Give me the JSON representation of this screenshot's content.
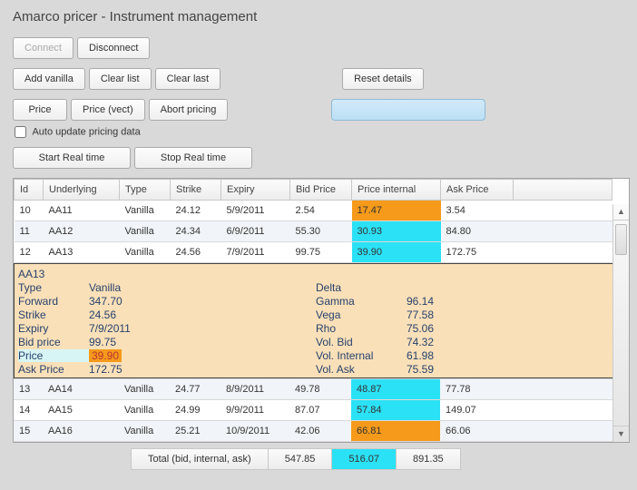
{
  "title": "Amarco pricer - Instrument management",
  "buttons": {
    "connect": "Connect",
    "disconnect": "Disconnect",
    "add_vanilla": "Add vanilla",
    "clear_list": "Clear list",
    "clear_last": "Clear last",
    "reset_details": "Reset details",
    "price": "Price",
    "price_vect": "Price (vect)",
    "abort_pricing": "Abort pricing",
    "start_rt": "Start Real time",
    "stop_rt": "Stop Real time"
  },
  "checkbox": {
    "auto_update": "Auto update pricing data"
  },
  "columns": {
    "id": "Id",
    "underlying": "Underlying",
    "type": "Type",
    "strike": "Strike",
    "expiry": "Expiry",
    "bid": "Bid Price",
    "internal": "Price internal",
    "ask": "Ask Price"
  },
  "rows": [
    {
      "id": "10",
      "underlying": "AA11",
      "type": "Vanilla",
      "strike": "24.12",
      "expiry": "5/9/2011",
      "bid": "2.54",
      "internal": "17.47",
      "ask": "3.54",
      "hl": "orange"
    },
    {
      "id": "11",
      "underlying": "AA12",
      "type": "Vanilla",
      "strike": "24.34",
      "expiry": "6/9/2011",
      "bid": "55.30",
      "internal": "30.93",
      "ask": "84.80",
      "hl": "cyan"
    },
    {
      "id": "12",
      "underlying": "AA13",
      "type": "Vanilla",
      "strike": "24.56",
      "expiry": "7/9/2011",
      "bid": "99.75",
      "internal": "39.90",
      "ask": "172.75",
      "hl": "cyan"
    },
    {
      "id": "13",
      "underlying": "AA14",
      "type": "Vanilla",
      "strike": "24.77",
      "expiry": "8/9/2011",
      "bid": "49.78",
      "internal": "48.87",
      "ask": "77.78",
      "hl": "cyan"
    },
    {
      "id": "14",
      "underlying": "AA15",
      "type": "Vanilla",
      "strike": "24.99",
      "expiry": "9/9/2011",
      "bid": "87.07",
      "internal": "57.84",
      "ask": "149.07",
      "hl": "cyan"
    },
    {
      "id": "15",
      "underlying": "AA16",
      "type": "Vanilla",
      "strike": "25.21",
      "expiry": "10/9/2011",
      "bid": "42.06",
      "internal": "66.81",
      "ask": "66.06",
      "hl": "orange"
    }
  ],
  "detail": {
    "name": "AA13",
    "type_label": "Type",
    "type_value": "Vanilla",
    "forward_label": "Forward",
    "forward_value": "347.70",
    "strike_label": "Strike",
    "strike_value": "24.56",
    "expiry_label": "Expiry",
    "expiry_value": "7/9/2011",
    "bid_label": "Bid price",
    "bid_value": "99.75",
    "price_label": "Price",
    "price_value": "39.90",
    "ask_label": "Ask Price",
    "ask_value": "172.75",
    "delta_label": "Delta",
    "delta_value": "",
    "gamma_label": "Gamma",
    "gamma_value": "96.14",
    "vega_label": "Vega",
    "vega_value": "77.58",
    "rho_label": "Rho",
    "rho_value": "75.06",
    "volbid_label": "Vol. Bid",
    "volbid_value": "74.32",
    "volint_label": "Vol. Internal",
    "volint_value": "61.98",
    "volask_label": "Vol. Ask",
    "volask_value": "75.59"
  },
  "totals": {
    "label": "Total (bid, internal, ask)",
    "bid": "547.85",
    "internal": "516.07",
    "ask": "891.35"
  }
}
